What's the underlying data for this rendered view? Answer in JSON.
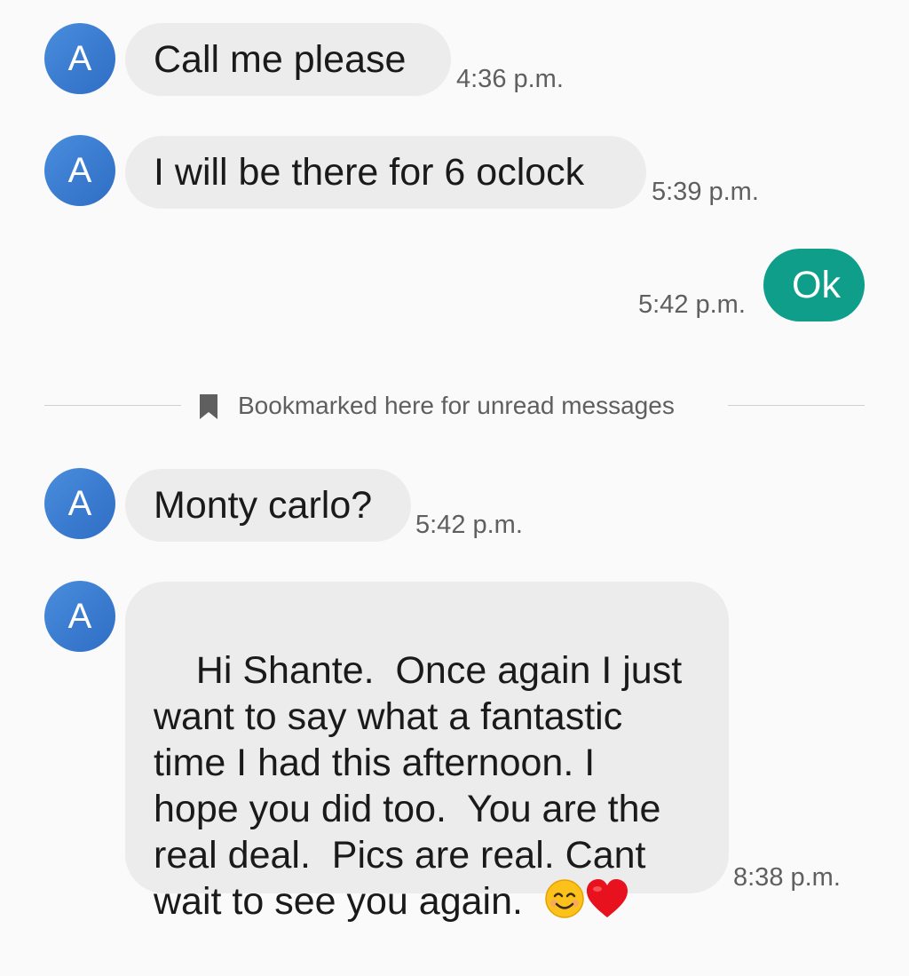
{
  "messages": [
    {
      "sender": "incoming",
      "avatar_letter": "A",
      "text": "Call me please",
      "time": "4:36 p.m."
    },
    {
      "sender": "incoming",
      "avatar_letter": "A",
      "text": "I will be there for 6 oclock",
      "time": "5:39 p.m."
    },
    {
      "sender": "outgoing",
      "text": "Ok",
      "time": "5:42 p.m."
    },
    {
      "sender": "incoming",
      "avatar_letter": "A",
      "text": "Monty carlo?",
      "time": "5:42 p.m."
    },
    {
      "sender": "incoming",
      "avatar_letter": "A",
      "text": "Hi Shante.  Once again I just\nwant to say what a fantastic\ntime I had this afternoon. I\nhope you did too.  You are the\nreal deal.  Pics are real. Cant\nwait to see you again.  ",
      "time": "8:38 p.m.",
      "emojis": [
        "smiling-face",
        "red-heart"
      ]
    }
  ],
  "divider": {
    "label": "Bookmarked here for unread messages",
    "icon": "bookmark-icon"
  },
  "colors": {
    "avatar": "#3a7bd0",
    "incoming_bubble": "#ececec",
    "outgoing_bubble": "#0e9e8a",
    "background": "#fafafa"
  }
}
